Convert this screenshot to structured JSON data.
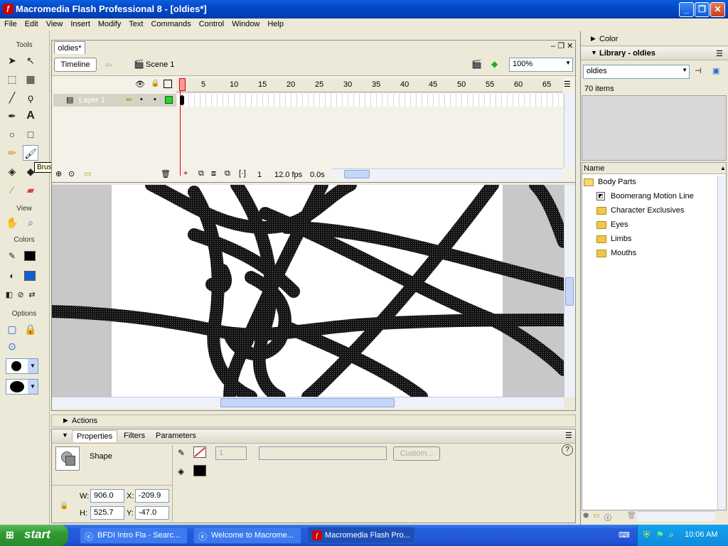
{
  "window": {
    "title": "Macromedia Flash Professional 8 - [oldies*]"
  },
  "menu": [
    "File",
    "Edit",
    "View",
    "Insert",
    "Modify",
    "Text",
    "Commands",
    "Control",
    "Window",
    "Help"
  ],
  "tools": {
    "header": "Tools",
    "view_header": "View",
    "colors_header": "Colors",
    "options_header": "Options",
    "stroke_color": "#000000",
    "fill_color": "#1060d0",
    "tooltip": "Brush Tool (B)"
  },
  "document": {
    "tab": "oldies*",
    "timeline_button": "Timeline",
    "scene": "Scene 1",
    "zoom": "100%",
    "layer_name": "Layer 1",
    "ruler_ticks": [
      "1",
      "5",
      "10",
      "15",
      "20",
      "25",
      "30",
      "35",
      "40",
      "45",
      "50",
      "55",
      "60",
      "65"
    ],
    "current_frame": "1",
    "fps": "12.0 fps",
    "elapsed": "0.0s"
  },
  "actions": {
    "label": "Actions"
  },
  "properties": {
    "tabs": [
      "Properties",
      "Filters",
      "Parameters"
    ],
    "kind": "Shape",
    "stroke_height": "1",
    "custom_button": "Custom...",
    "W": "906.0",
    "X": "-209.9",
    "H": "525.7",
    "Y": "-47.0",
    "labels": {
      "w": "W:",
      "h": "H:",
      "x": "X:",
      "y": "Y:"
    },
    "help": "?"
  },
  "right": {
    "color_panel": "Color",
    "library_panel": "Library - oldies",
    "library_select": "oldies",
    "item_count": "70 items",
    "name_header": "Name",
    "items": [
      {
        "name": "Body Parts",
        "type": "folder-open",
        "indent": 0
      },
      {
        "name": "Boomerang Motion Line",
        "type": "symbol",
        "indent": 1
      },
      {
        "name": "Character Exclusives",
        "type": "folder",
        "indent": 1
      },
      {
        "name": "Eyes",
        "type": "folder",
        "indent": 1
      },
      {
        "name": "Limbs",
        "type": "folder",
        "indent": 1
      },
      {
        "name": "Mouths",
        "type": "folder",
        "indent": 1
      }
    ]
  },
  "taskbar": {
    "start": "start",
    "tasks": [
      "BFDI Intro Fla - Searc...",
      "Welcome to Macrome...",
      "Macromedia Flash Pro..."
    ],
    "clock": "10:06 AM"
  }
}
